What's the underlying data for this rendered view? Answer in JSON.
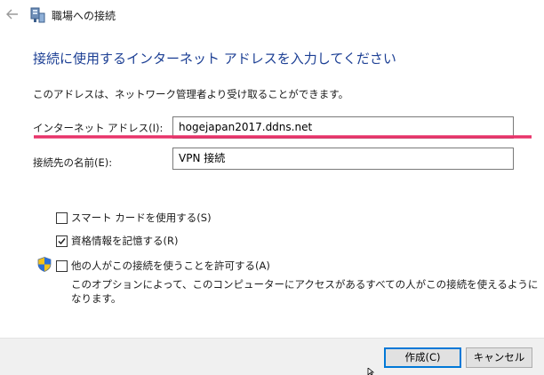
{
  "window": {
    "title": "職場への接続"
  },
  "heading": "接続に使用するインターネット アドレスを入力してください",
  "description": "このアドレスは、ネットワーク管理者より受け取ることができます。",
  "fields": {
    "internet_address": {
      "label": "インターネット アドレス(I):",
      "value": "hogejapan2017.ddns.net"
    },
    "destination_name": {
      "label": "接続先の名前(E):",
      "value": "VPN 接続"
    }
  },
  "options": {
    "smart_card": {
      "label": "スマート カードを使用する(S)",
      "checked": false
    },
    "remember_credentials": {
      "label": "資格情報を記憶する(R)",
      "checked": true
    },
    "allow_others": {
      "label": "他の人がこの接続を使うことを許可する(A)",
      "checked": false
    },
    "allow_others_note": "このオプションによって、このコンピューターにアクセスがあるすべての人がこの接続を使えるようになります。"
  },
  "buttons": {
    "create": "作成(C)",
    "cancel": "キャンセル"
  },
  "colors": {
    "heading": "#1c3f94",
    "highlight_underline": "#e8336a",
    "primary_border": "#0078d7"
  },
  "icons": {
    "back": "back-arrow-icon",
    "app": "network-icon",
    "shield": "uac-shield-icon"
  }
}
